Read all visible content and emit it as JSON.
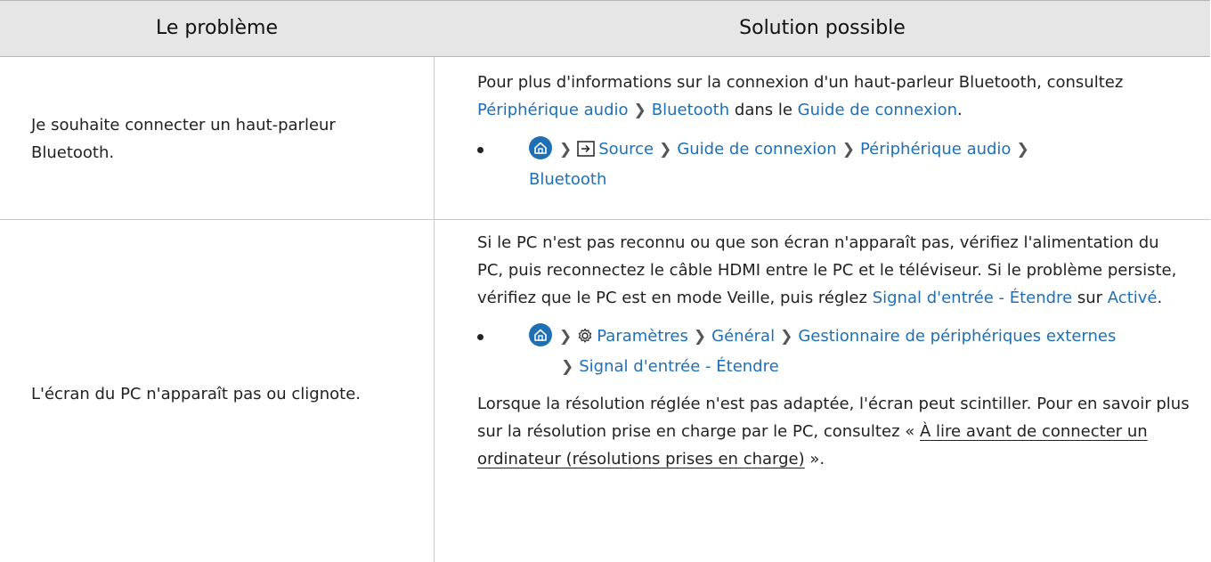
{
  "table": {
    "headers": [
      "Le problème",
      "Solution possible"
    ],
    "rows": [
      {
        "problem": "Je souhaite connecter un haut-parleur Bluetooth.",
        "solution": {
          "intro": "Pour plus d'informations sur la connexion d'un haut-parleur Bluetooth, consultez",
          "link1": "Périphérique audio",
          "link2": "Bluetooth",
          "mid": "dans le",
          "link3": "Guide de connexion",
          "end": ".",
          "path": [
            "Source",
            "Guide de connexion",
            "Périphérique audio",
            "Bluetooth"
          ]
        }
      },
      {
        "problem": "L'écran du PC n'apparaît pas ou clignote.",
        "solution": {
          "para1": "Si le PC n'est pas reconnu ou que son écran n'apparaît pas, vérifiez l'alimentation du PC, puis reconnectez le câble HDMI entre le PC et le téléviseur. Si le problème persiste, vérifiez que le PC est en mode Veille, puis réglez",
          "link_signal": "Signal d'entrée - Étendre",
          "sur": "sur",
          "link_active": "Activé",
          "end": ".",
          "path": [
            "Paramètres",
            "Général",
            "Gestionnaire de périphériques externes",
            "Signal d'entrée - Étendre"
          ],
          "para2": "Lorsque la résolution réglée n'est pas adaptée, l'écran peut scintiller. Pour en savoir plus sur la résolution prise en charge par le PC, consultez «",
          "ref": "À lire avant de connecter un ordinateur (résolutions prises en charge)",
          "close": "»."
        }
      }
    ]
  },
  "colors": {
    "link": "#1f6fb5",
    "header_bg": "#e6e6e6"
  },
  "icons": [
    "home-icon",
    "source-icon",
    "settings-icon",
    "chevron-right-icon"
  ],
  "sep": "❯"
}
